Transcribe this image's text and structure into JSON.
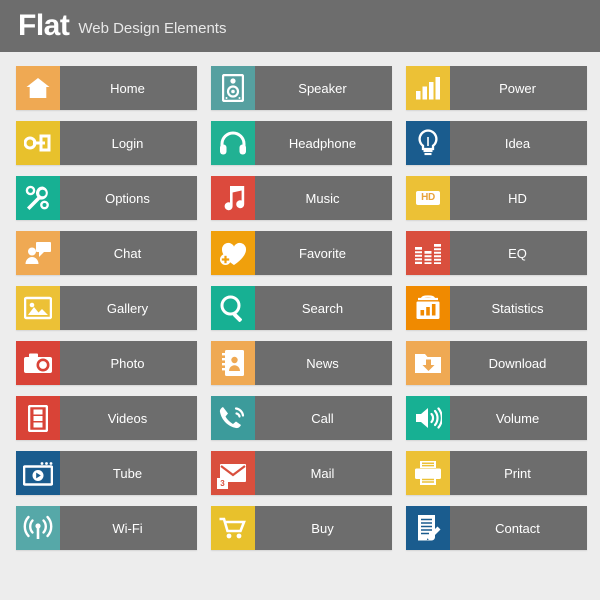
{
  "header": {
    "title": "Flat",
    "subtitle": "Web Design Elements",
    "bar_color": "#6d6d6d",
    "title_color": "#ffffff"
  },
  "page": {
    "background_color": "#ededed",
    "label_panel_color": "#6d6d6d",
    "label_text_color": "#ffffff"
  },
  "buttons": [
    {
      "label": "Home",
      "icon": "house-icon",
      "color": "#efa953"
    },
    {
      "label": "Speaker",
      "icon": "speaker-box-icon",
      "color": "#56a0a0"
    },
    {
      "label": "Power",
      "icon": "signal-bars-icon",
      "color": "#ecc136"
    },
    {
      "label": "Login",
      "icon": "key-icon",
      "color": "#e8c12c"
    },
    {
      "label": "Headphone",
      "icon": "headphones-icon",
      "color": "#21b193"
    },
    {
      "label": "Idea",
      "icon": "lightbulb-icon",
      "color": "#1f6header"
    },
    {
      "label": "Options",
      "icon": "wrench-gear-icon",
      "color": "#17b093"
    },
    {
      "label": "Music",
      "icon": "music-note-icon",
      "color": "#dc4a3d"
    },
    {
      "label": "HD",
      "icon": "hd-badge-icon",
      "color": "#ecc136"
    },
    {
      "label": "Chat",
      "icon": "person-chat-icon",
      "color": "#efa953"
    },
    {
      "label": "Favorite",
      "icon": "heart-plus-icon",
      "color": "#f0a00c"
    },
    {
      "label": "EQ",
      "icon": "equalizer-icon",
      "color": "#d94f3d"
    },
    {
      "label": "Gallery",
      "icon": "gallery-image-icon",
      "color": "#ecc136"
    },
    {
      "label": "Search",
      "icon": "magnifier-icon",
      "color": "#17b093"
    },
    {
      "label": "Statistics",
      "icon": "chart-board-icon",
      "color": "#f08a00"
    },
    {
      "label": "Photo",
      "icon": "camera-icon",
      "color": "#d94337"
    },
    {
      "label": "News",
      "icon": "contact-book-icon",
      "color": "#efa953"
    },
    {
      "label": "Download",
      "icon": "download-folder-icon",
      "color": "#efa953"
    },
    {
      "label": "Videos",
      "icon": "film-strip-icon",
      "color": "#d94337"
    },
    {
      "label": "Call",
      "icon": "phone-ring-icon",
      "color": "#3c9b9b"
    },
    {
      "label": "Volume",
      "icon": "volume-speaker-icon",
      "color": "#17b093"
    },
    {
      "label": "Tube",
      "icon": "video-player-icon",
      "color": "#1a5c8e"
    },
    {
      "label": "Mail",
      "icon": "envelope-icon",
      "color": "#d94f3d",
      "badge": "3"
    },
    {
      "label": "Print",
      "icon": "printer-icon",
      "color": "#ecc136"
    },
    {
      "label": "Wi-Fi",
      "icon": "wifi-signal-icon",
      "color": "#56a8a8"
    },
    {
      "label": "Buy",
      "icon": "shopping-cart-icon",
      "color": "#e8c12c"
    },
    {
      "label": "Contact",
      "icon": "document-pen-icon",
      "color": "#1a5c8e"
    }
  ],
  "icon_color": "#ffffff"
}
